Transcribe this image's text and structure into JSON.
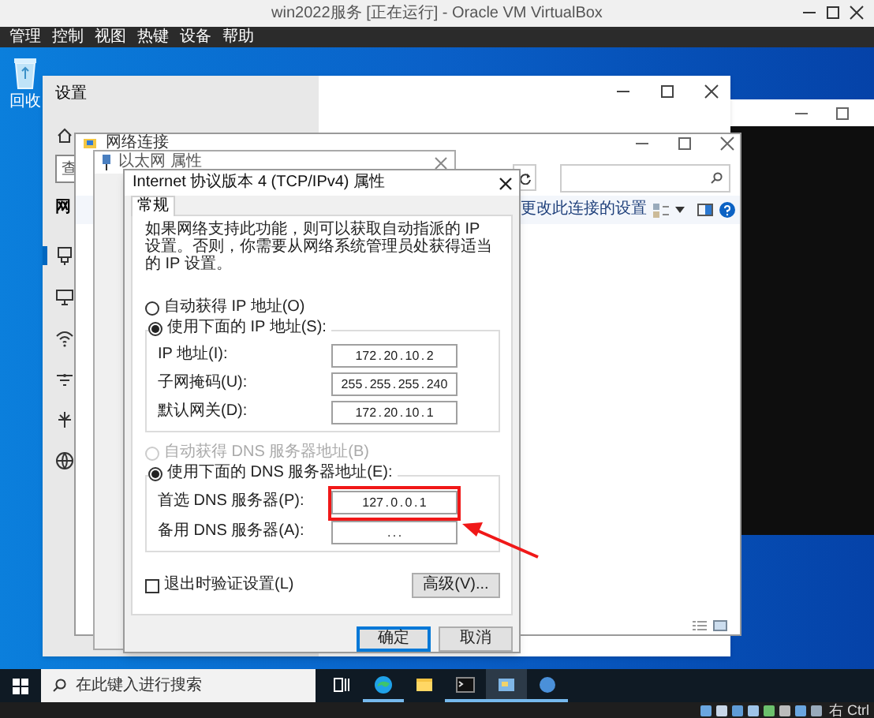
{
  "vbox_window": {
    "title": "win2022服务 [正在运行] - Oracle VM VirtualBox",
    "menu": [
      "管理",
      "控制",
      "视图",
      "热键",
      "设备",
      "帮助"
    ],
    "host_key": "右 Ctrl"
  },
  "desktop_icons": [
    {
      "label": "回收"
    }
  ],
  "settings_window": {
    "title": "设置",
    "search_placeholder": "查",
    "section": "网",
    "nav": [
      {
        "selected": true
      },
      {
        "selected": false
      },
      {
        "selected": false
      },
      {
        "selected": false
      },
      {
        "selected": false
      },
      {
        "selected": false
      }
    ]
  },
  "network_window": {
    "title": "网络连接",
    "command": "更改此连接的设置"
  },
  "ethernet_properties": {
    "title": "以太网 属性"
  },
  "ipv4_dialog": {
    "title": "Internet 协议版本 4 (TCP/IPv4) 属性",
    "tabs": [
      {
        "label": "常规",
        "selected": true
      }
    ],
    "intro": "如果网络支持此功能，则可以获取自动指派的 IP 设置。否则，你需要从网络系统管理员处获得适当的 IP 设置。",
    "ip_options": [
      {
        "label": "自动获得 IP 地址(O)",
        "selected": false,
        "disabled": false
      },
      {
        "label": "使用下面的 IP 地址(S):",
        "selected": true,
        "disabled": false
      }
    ],
    "ip_fields": [
      {
        "label": "IP 地址(I):",
        "value": "172 . 20 . 10 . 2",
        "highlighted": false
      },
      {
        "label": "子网掩码(U):",
        "value": "255 . 255 . 255 . 240",
        "highlighted": false
      },
      {
        "label": "默认网关(D):",
        "value": "172 . 20 . 10 . 1",
        "highlighted": false
      }
    ],
    "dns_options": [
      {
        "label": "自动获得 DNS 服务器地址(B)",
        "selected": false,
        "disabled": true
      },
      {
        "label": "使用下面的 DNS 服务器地址(E):",
        "selected": true,
        "disabled": false
      }
    ],
    "dns_fields": [
      {
        "label": "首选 DNS 服务器(P):",
        "value": "127 . 0 . 0 . 1",
        "highlighted": true
      },
      {
        "label": "备用 DNS 服务器(A):",
        "value": ". . .",
        "highlighted": false
      }
    ],
    "validate_on_exit": {
      "label": "退出时验证设置(L)",
      "checked": false
    },
    "advanced_button": "高级(V)...",
    "buttons": [
      {
        "label": "确定",
        "default": true
      },
      {
        "label": "取消",
        "default": false
      }
    ]
  },
  "taskbar": {
    "search_placeholder": "在此键入进行搜索",
    "apps": [
      {
        "running": false,
        "active": false
      },
      {
        "running": true,
        "active": false
      },
      {
        "running": false,
        "active": false
      },
      {
        "running": true,
        "active": false
      },
      {
        "running": true,
        "active": true
      },
      {
        "running": true,
        "active": false
      }
    ]
  }
}
